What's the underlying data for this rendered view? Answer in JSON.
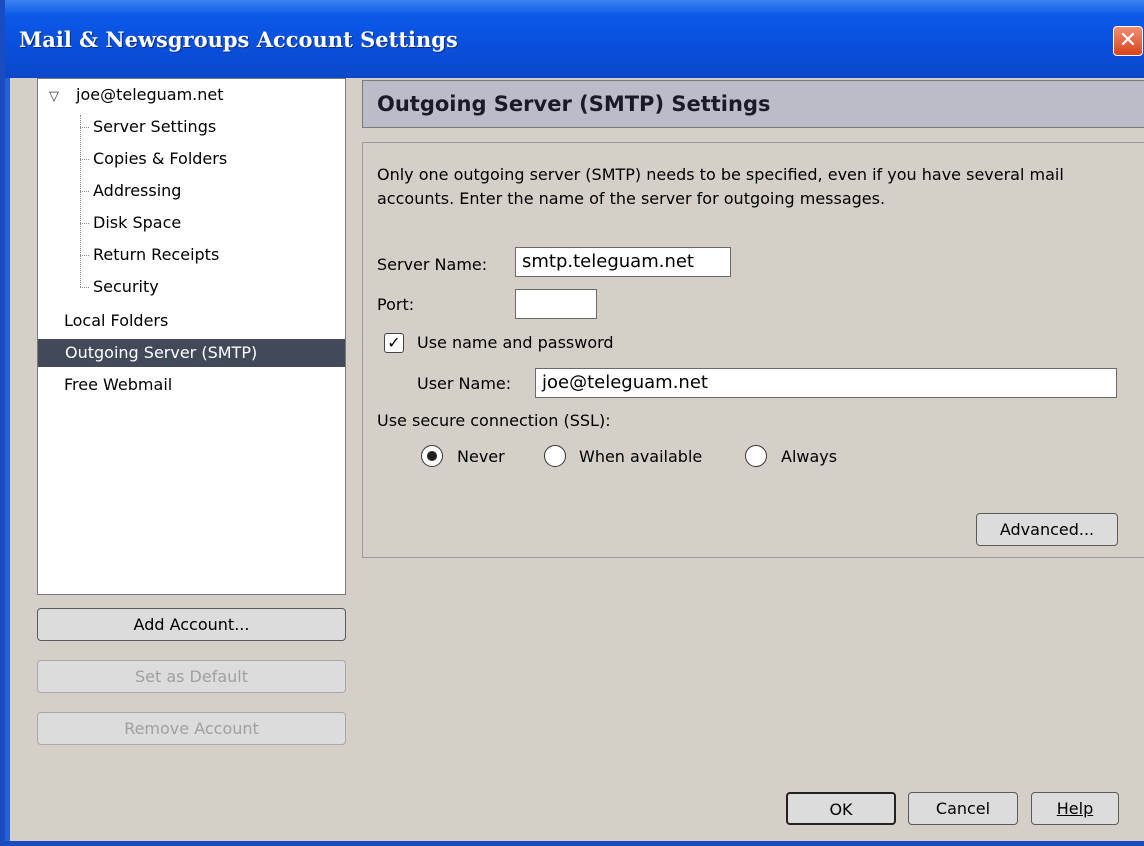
{
  "window": {
    "title": "Mail & Newsgroups Account Settings",
    "close_label": "✕"
  },
  "tree": {
    "expander": "▽",
    "account": "joe@teleguam.net",
    "children": [
      "Server Settings",
      "Copies & Folders",
      "Addressing",
      "Disk Space",
      "Return Receipts",
      "Security"
    ],
    "local_folders": "Local Folders",
    "outgoing": "Outgoing Server (SMTP)",
    "webmail": "Free Webmail"
  },
  "buttons": {
    "add_account": "Add Account...",
    "set_default": "Set as Default",
    "remove_account": "Remove Account",
    "advanced": "Advanced...",
    "ok": "OK",
    "cancel": "Cancel",
    "help": "Help"
  },
  "panel": {
    "header": "Outgoing Server (SMTP) Settings",
    "description": "Only one outgoing server (SMTP) needs to be specified, even if you have several mail accounts. Enter the name of the server for outgoing messages.",
    "server_name_label": "Server Name:",
    "server_name_value": "smtp.teleguam.net",
    "port_label": "Port:",
    "port_value": "",
    "use_name_password_label": "Use name and password",
    "use_name_password_checked": true,
    "user_name_label": "User Name:",
    "user_name_value": "joe@teleguam.net",
    "ssl_label": "Use secure connection (SSL):",
    "ssl_options": [
      "Never",
      "When available",
      "Always"
    ],
    "ssl_selected": "Never"
  }
}
